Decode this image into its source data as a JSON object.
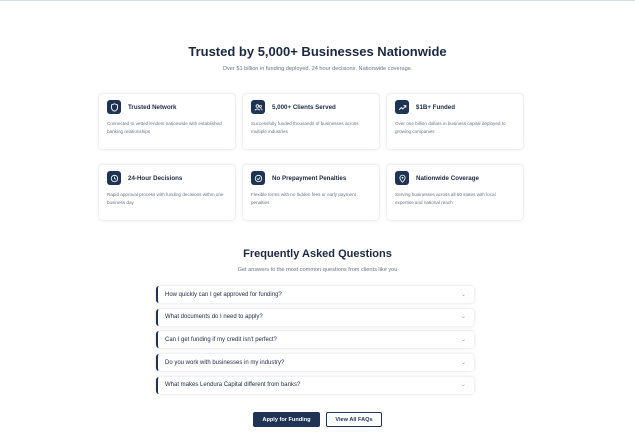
{
  "hero": {
    "title": "Trusted by 5,000+ Businesses Nationwide",
    "subtitle": "Over $1 billion in funding deployed. 24 hour decisions. Nationwide coverage."
  },
  "features": [
    {
      "icon": "shield-icon",
      "title": "Trusted Network",
      "desc": "Connected to vetted lenders nationwide with established banking relationships"
    },
    {
      "icon": "users-icon",
      "title": "5,000+ Clients Served",
      "desc": "Successfully funded thousands of businesses across multiple industries"
    },
    {
      "icon": "trending-up-icon",
      "title": "$1B+ Funded",
      "desc": "Over one billion dollars in business capital deployed to growing companies"
    },
    {
      "icon": "clock-icon",
      "title": "24-Hour Decisions",
      "desc": "Rapid approval process with funding decisions within one business day"
    },
    {
      "icon": "check-circle-icon",
      "title": "No Prepayment Penalties",
      "desc": "Flexible terms with no hidden fees or early payment penalties"
    },
    {
      "icon": "map-pin-icon",
      "title": "Nationwide Coverage",
      "desc": "Serving businesses across all 50 states with local expertise and national reach"
    }
  ],
  "faq": {
    "title": "Frequently Asked Questions",
    "subtitle": "Get answers to the most common questions from clients like you",
    "items": [
      "How quickly can I get approved for funding?",
      "What documents do I need to apply?",
      "Can I get funding if my credit isn't perfect?",
      "Do you work with businesses in my industry?",
      "What makes Lendura Capital different from banks?"
    ]
  },
  "actions": {
    "apply_label": "Apply for Funding",
    "view_all_label": "View All FAQs"
  },
  "colors": {
    "accent": "#1f3354",
    "text": "#1c2740",
    "muted": "#6b7385"
  }
}
